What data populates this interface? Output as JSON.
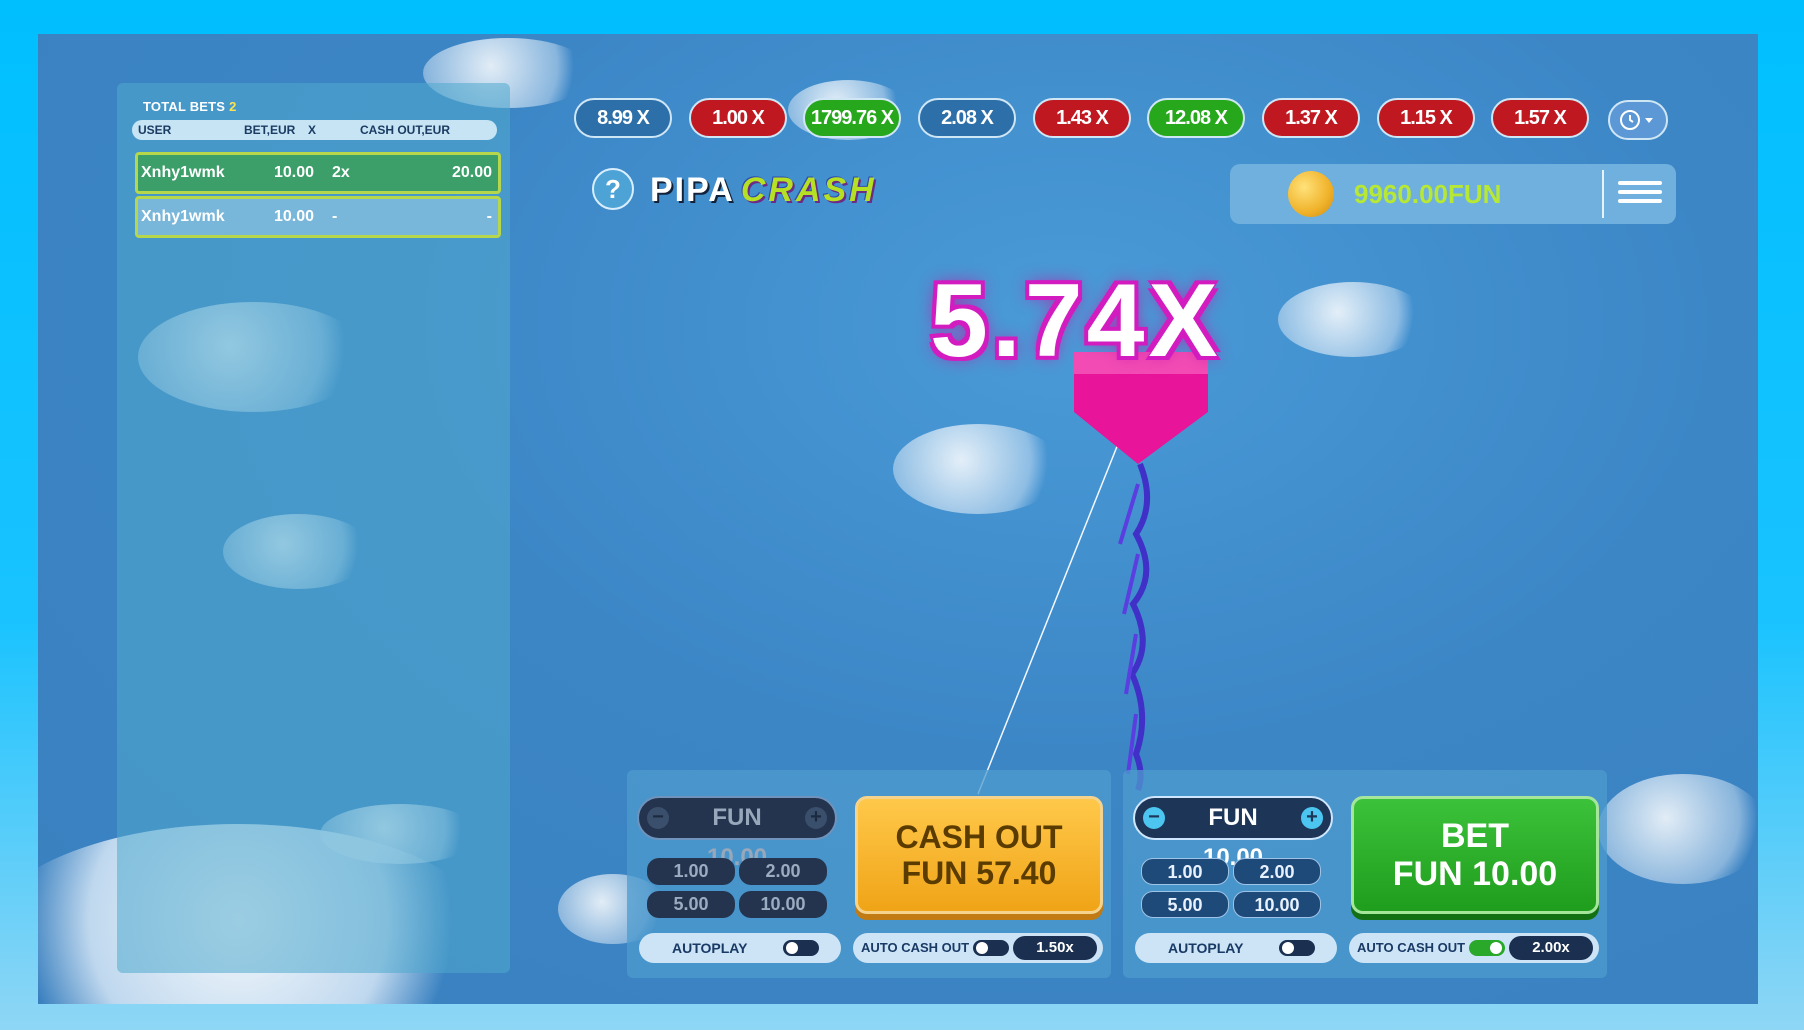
{
  "bets_panel": {
    "title": "TOTAL BETS",
    "count": "2",
    "columns": [
      "USER",
      "BET,EUR",
      "X",
      "CASH OUT,EUR"
    ],
    "rows": [
      {
        "user": "Xnhy1wmk",
        "bet": "10.00",
        "x": "2x",
        "cashout": "20.00",
        "status": "won"
      },
      {
        "user": "Xnhy1wmk",
        "bet": "10.00",
        "x": "-",
        "cashout": "-",
        "status": "pending"
      }
    ]
  },
  "history": [
    {
      "label": "8.99 X",
      "color": "blue"
    },
    {
      "label": "1.00 X",
      "color": "red"
    },
    {
      "label": "1799.76 X",
      "color": "green"
    },
    {
      "label": "2.08 X",
      "color": "blue"
    },
    {
      "label": "1.43 X",
      "color": "red"
    },
    {
      "label": "12.08 X",
      "color": "green"
    },
    {
      "label": "1.37 X",
      "color": "red"
    },
    {
      "label": "1.15 X",
      "color": "red"
    },
    {
      "label": "1.57 X",
      "color": "red"
    }
  ],
  "header": {
    "help": "?",
    "logo_left": "PIPA",
    "logo_right": "CRASH",
    "balance": "9960.00FUN"
  },
  "game": {
    "multiplier": "5.74X"
  },
  "panel_left": {
    "stake": "FUN 10.00",
    "chips": [
      "1.00",
      "2.00",
      "5.00",
      "10.00"
    ],
    "button_line1": "CASH OUT",
    "button_line2": "FUN 57.40",
    "autoplay_label": "AUTOPLAY",
    "autoplay_on": false,
    "auto_cashout_label": "AUTO CASH OUT",
    "auto_cashout_on": false,
    "auto_cashout_value": "1.50x"
  },
  "panel_right": {
    "stake": "FUN 10.00",
    "chips": [
      "1.00",
      "2.00",
      "5.00",
      "10.00"
    ],
    "button_line1": "BET",
    "button_line2": "FUN 10.00",
    "autoplay_label": "AUTOPLAY",
    "autoplay_on": false,
    "auto_cashout_label": "AUTO CASH OUT",
    "auto_cashout_on": true,
    "auto_cashout_value": "2.00x"
  },
  "colors": {
    "pill_red": "#c01820",
    "pill_green": "#27a81c",
    "pill_blue": "#2d6fa8",
    "balance_text": "#b6e835",
    "kite": "#e8149a",
    "multiplier_glow": "#d21cc0"
  }
}
